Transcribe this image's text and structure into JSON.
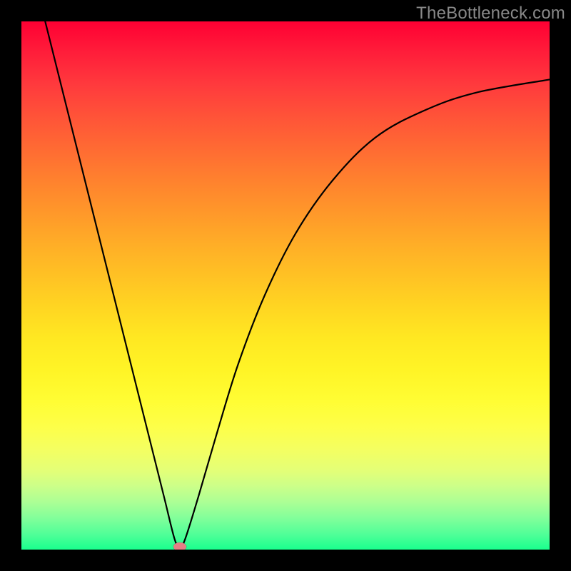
{
  "watermark": "TheBottleneck.com",
  "chart_data": {
    "type": "line",
    "title": "",
    "xlabel": "",
    "ylabel": "",
    "xlim": [
      0,
      1
    ],
    "ylim": [
      0,
      1
    ],
    "marker": {
      "x": 0.3,
      "y": 0.005
    },
    "curve": [
      {
        "x": 0.045,
        "y": 1.0
      },
      {
        "x": 0.07,
        "y": 0.9
      },
      {
        "x": 0.095,
        "y": 0.8
      },
      {
        "x": 0.12,
        "y": 0.7
      },
      {
        "x": 0.145,
        "y": 0.6
      },
      {
        "x": 0.17,
        "y": 0.5
      },
      {
        "x": 0.195,
        "y": 0.4
      },
      {
        "x": 0.22,
        "y": 0.3
      },
      {
        "x": 0.245,
        "y": 0.2
      },
      {
        "x": 0.27,
        "y": 0.1
      },
      {
        "x": 0.29,
        "y": 0.02
      },
      {
        "x": 0.3,
        "y": 0.005
      },
      {
        "x": 0.31,
        "y": 0.02
      },
      {
        "x": 0.335,
        "y": 0.1
      },
      {
        "x": 0.37,
        "y": 0.22
      },
      {
        "x": 0.41,
        "y": 0.35
      },
      {
        "x": 0.46,
        "y": 0.48
      },
      {
        "x": 0.52,
        "y": 0.6
      },
      {
        "x": 0.59,
        "y": 0.7
      },
      {
        "x": 0.67,
        "y": 0.78
      },
      {
        "x": 0.76,
        "y": 0.83
      },
      {
        "x": 0.86,
        "y": 0.865
      },
      {
        "x": 1.0,
        "y": 0.89
      }
    ],
    "background_gradient": {
      "top": "#ff0033",
      "mid_upper": "#ff972a",
      "mid_lower": "#fffd34",
      "bottom": "#1aff8e"
    }
  }
}
